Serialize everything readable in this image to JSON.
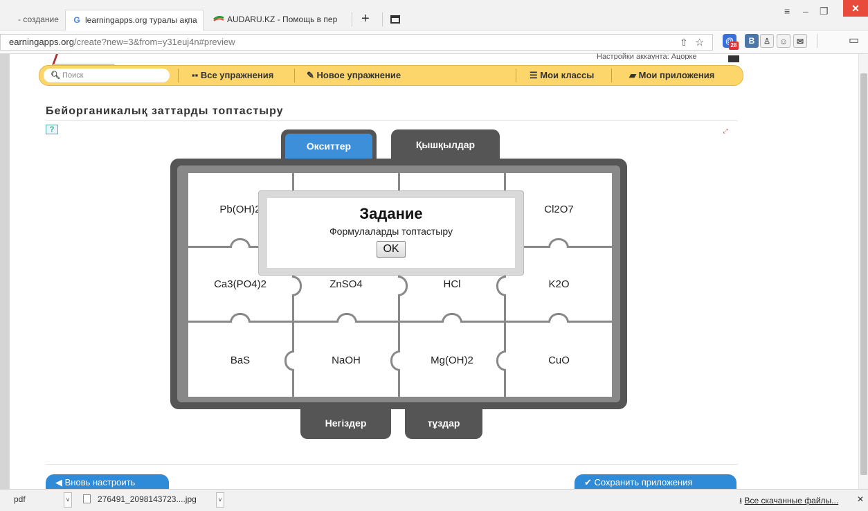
{
  "browser": {
    "tabs": [
      {
        "label": "- создание",
        "favicon": ""
      },
      {
        "label": "learningapps.org туралы ақпа",
        "favicon": "G"
      },
      {
        "label": "AUDARU.KZ - Помощь в пер",
        "favicon": "audaru-icon"
      }
    ],
    "new_tab_label": "+",
    "url_host": "earningapps.org",
    "url_path": "/create?new=3&from=y31euj4n#preview",
    "mail_badge": "28",
    "ext_vk": "B",
    "ext_ok": "ok"
  },
  "page": {
    "account_text": "Настройки аккаунта: Ацорке",
    "search_placeholder": "Поиск",
    "menu": {
      "all_exercises": "Все упражнения",
      "new_exercise": "Новое упражнение",
      "my_classes": "Мои классы",
      "my_apps": "Мои приложения"
    },
    "title": "Бейорганикалық заттарды топтастыру",
    "buttons": {
      "reset": "Вновь настроить",
      "save": "Сохранить приложения"
    }
  },
  "puzzle": {
    "categories": {
      "top_left": "Окситтер",
      "top_right": "Қышқылдар",
      "bottom_left": "Негіздер",
      "bottom_right": "тұздар"
    },
    "rows": [
      [
        "Pb(OH)2",
        "",
        "",
        "Cl2O7"
      ],
      [
        "Ca3(PO4)2",
        "ZnSO4",
        "HCl",
        "K2O"
      ],
      [
        "BaS",
        "NaOH",
        "Mg(OH)2",
        "CuO"
      ]
    ]
  },
  "dialog": {
    "title": "Задание",
    "text": "Формулаларды топтастыру",
    "ok": "OK"
  },
  "downloads": {
    "item1": "pdf",
    "item2": "276491_2098143723....jpg",
    "all_files": "Все скачанные файлы..."
  },
  "colors": {
    "menubar": "#fcd56b",
    "active_category": "#3c8fd8",
    "inactive_category": "#555555",
    "button_blue": "#2f8ad8"
  }
}
